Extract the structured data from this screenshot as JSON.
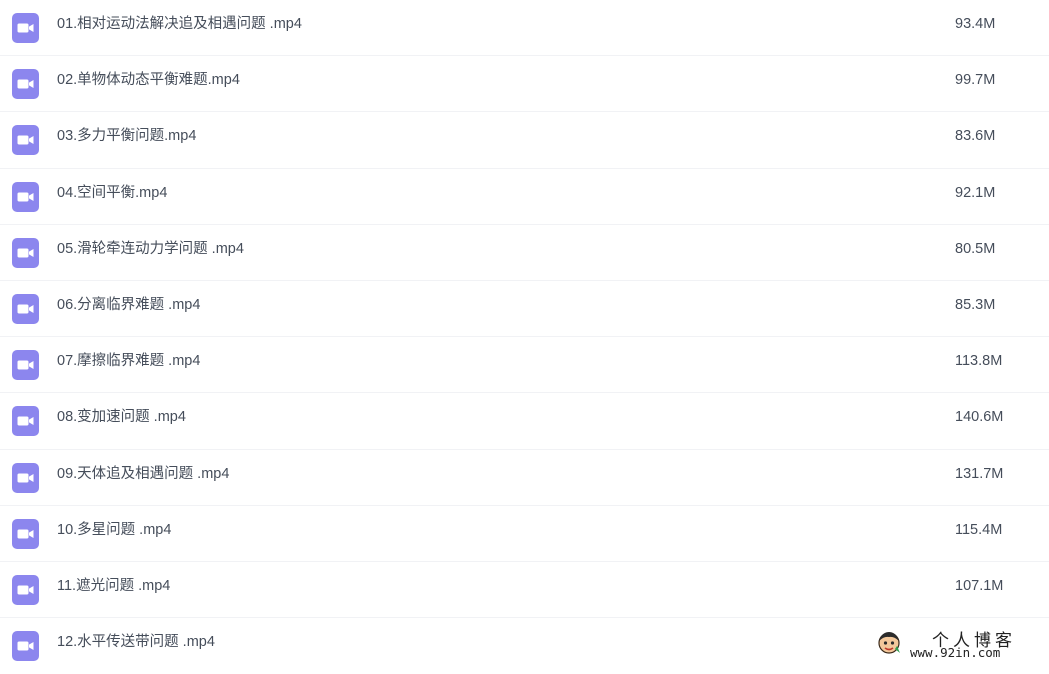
{
  "colors": {
    "icon_bg": "#8c86ee",
    "icon_fg": "#ffffff",
    "text": "#454d5a",
    "divider": "#f1f2f5"
  },
  "icons": {
    "file_type": "video-file-icon"
  },
  "files": [
    {
      "name": "01.相对运动法解决追及相遇问题 .mp4",
      "size": "93.4M"
    },
    {
      "name": "02.单物体动态平衡难题.mp4",
      "size": "99.7M"
    },
    {
      "name": "03.多力平衡问题.mp4",
      "size": "83.6M"
    },
    {
      "name": "04.空间平衡.mp4",
      "size": "92.1M"
    },
    {
      "name": "05.滑轮牵连动力学问题 .mp4",
      "size": "80.5M"
    },
    {
      "name": "06.分离临界难题 .mp4",
      "size": "85.3M"
    },
    {
      "name": "07.摩擦临界难题 .mp4",
      "size": "113.8M"
    },
    {
      "name": "08.变加速问题 .mp4",
      "size": "140.6M"
    },
    {
      "name": "09.天体追及相遇问题 .mp4",
      "size": "131.7M"
    },
    {
      "name": "10.多星问题 .mp4",
      "size": "115.4M"
    },
    {
      "name": "11.遮光问题 .mp4",
      "size": "107.1M"
    },
    {
      "name": "12.水平传送带问题 .mp4",
      "size": ""
    }
  ],
  "watermark": {
    "title": "个人博客",
    "url": "www.92in.com"
  }
}
